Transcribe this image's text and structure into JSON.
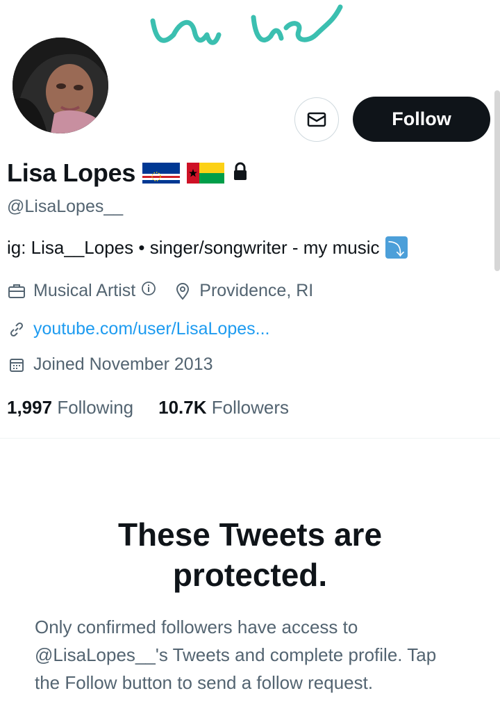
{
  "banner": {
    "script_text": "la lis",
    "accent_color": "#3bbfb0"
  },
  "profile": {
    "name": "Lisa Lopes",
    "flags": [
      "cape-verde-flag",
      "guinea-bissau-flag"
    ],
    "protected_icon": "lock-icon",
    "handle": "@LisaLopes__",
    "bio": "ig: Lisa__Lopes • singer/songwriter - my music",
    "bio_emoji": "⤵",
    "category": "Musical Artist",
    "location": "Providence, RI",
    "website": "youtube.com/user/LisaLopes...",
    "joined": "Joined November 2013"
  },
  "actions": {
    "follow_label": "Follow",
    "message_icon": "envelope-icon"
  },
  "stats": {
    "following_count": "1,997",
    "following_label": "Following",
    "followers_count": "10.7K",
    "followers_label": "Followers"
  },
  "protected": {
    "title_line1": "These Tweets are",
    "title_line2": "protected.",
    "body": "Only confirmed followers have access to @LisaLopes__'s Tweets and complete profile. Tap the Follow button to send a follow request."
  },
  "colors": {
    "text": "#0f1419",
    "secondary": "#536471",
    "link": "#1d9bf0",
    "button": "#0f1419"
  }
}
